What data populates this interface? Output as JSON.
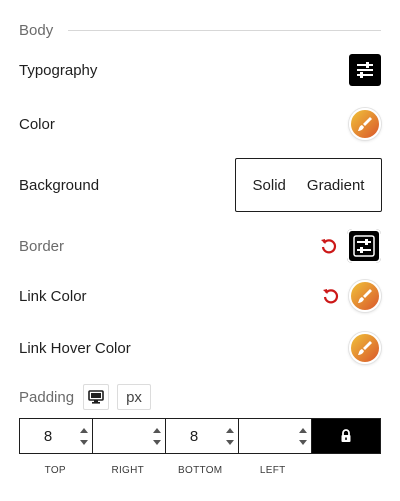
{
  "section": {
    "title": "Body"
  },
  "rows": {
    "typography": {
      "label": "Typography",
      "icon": "sliders-icon"
    },
    "color": {
      "label": "Color",
      "icon": "brush-icon",
      "swatch": "#e8a33a"
    },
    "background": {
      "label": "Background",
      "options": [
        "Solid",
        "Gradient"
      ]
    },
    "border": {
      "label": "Border",
      "icon": "sliders-icon"
    },
    "link_color": {
      "label": "Link Color",
      "icon": "brush-icon"
    },
    "link_hover_color": {
      "label": "Link Hover Color",
      "icon": "brush-icon"
    }
  },
  "padding": {
    "label": "Padding",
    "device_icon": "desktop-icon",
    "unit": "px",
    "values": {
      "top": "8",
      "right": "",
      "bottom": "8",
      "left": ""
    },
    "labels": {
      "top": "TOP",
      "right": "RIGHT",
      "bottom": "BOTTOM",
      "left": "LEFT"
    },
    "lock_icon": "lock-icon"
  },
  "colors": {
    "reset": "#cc1818",
    "swatch_start": "#f0c23a",
    "swatch_end": "#d9562b"
  }
}
